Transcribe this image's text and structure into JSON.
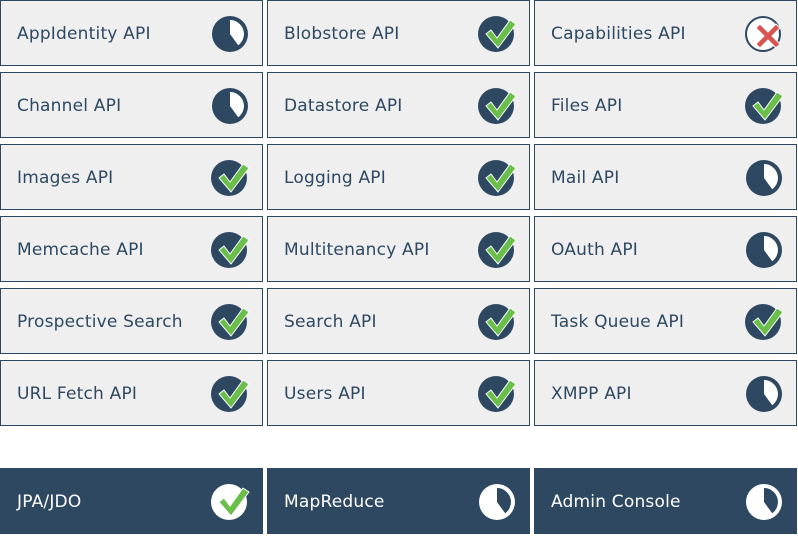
{
  "colors": {
    "navy": "#2e4862",
    "tile_bg": "#efefef",
    "check": "#6abf4b",
    "cross": "#d9534f"
  },
  "apis": [
    {
      "label": "AppIdentity API",
      "icon": "pie-clock-icon"
    },
    {
      "label": "Blobstore API",
      "icon": "check-icon"
    },
    {
      "label": "Capabilities API",
      "icon": "cross-icon"
    },
    {
      "label": "Channel API",
      "icon": "pie-clock-icon"
    },
    {
      "label": "Datastore API",
      "icon": "check-icon"
    },
    {
      "label": "Files API",
      "icon": "check-icon"
    },
    {
      "label": "Images API",
      "icon": "check-icon"
    },
    {
      "label": "Logging API",
      "icon": "check-icon"
    },
    {
      "label": "Mail API",
      "icon": "pie-clock-icon"
    },
    {
      "label": "Memcache API",
      "icon": "check-icon"
    },
    {
      "label": "Multitenancy API",
      "icon": "check-icon"
    },
    {
      "label": "OAuth API",
      "icon": "pie-clock-icon"
    },
    {
      "label": "Prospective Search",
      "icon": "check-icon"
    },
    {
      "label": "Search API",
      "icon": "check-icon"
    },
    {
      "label": "Task Queue API",
      "icon": "check-icon"
    },
    {
      "label": "URL Fetch API",
      "icon": "check-icon"
    },
    {
      "label": "Users API",
      "icon": "check-icon"
    },
    {
      "label": "XMPP API",
      "icon": "pie-clock-icon"
    }
  ],
  "extras": [
    {
      "label": "JPA/JDO",
      "icon": "check-icon"
    },
    {
      "label": "MapReduce",
      "icon": "pie-clock-icon"
    },
    {
      "label": "Admin Console",
      "icon": "pie-clock-icon"
    }
  ]
}
